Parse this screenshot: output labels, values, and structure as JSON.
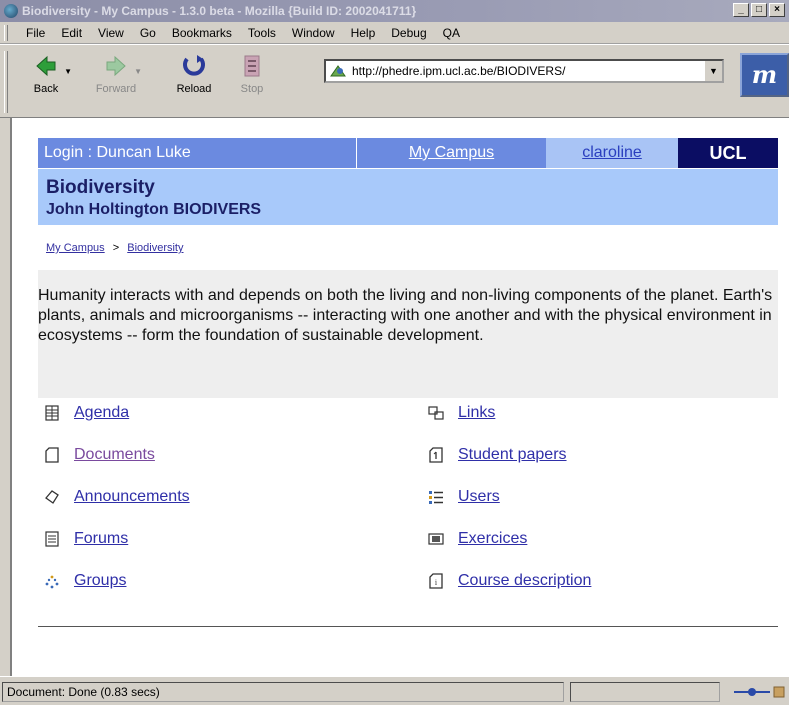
{
  "window": {
    "title": "Biodiversity - My Campus - 1.3.0 beta - Mozilla {Build ID: 2002041711}",
    "controls": [
      "_",
      "□",
      "×"
    ]
  },
  "menu": {
    "items": [
      "File",
      "Edit",
      "View",
      "Go",
      "Bookmarks",
      "Tools",
      "Window",
      "Help",
      "Debug",
      "QA"
    ]
  },
  "toolbar": {
    "back": "Back",
    "forward": "Forward",
    "reload": "Reload",
    "stop": "Stop",
    "url": "http://phedre.ipm.ucl.ac.be/BIODIVERS/"
  },
  "header": {
    "login": "Login : Duncan Luke",
    "my_campus": "My Campus",
    "claroline": "claroline",
    "ucl": "UCL"
  },
  "course": {
    "title": "Biodiversity",
    "subtitle": "John Holtington BIODIVERS"
  },
  "breadcrumb": {
    "home": "My Campus",
    "separator": ">",
    "current": "Biodiversity"
  },
  "description": "Humanity interacts with and depends on both the living and non-living components of the planet. Earth's plants, animals and microorganisms -- interacting with one another and with the physical environment in ecosystems -- form the foundation of sustainable development.",
  "tools": {
    "left": [
      {
        "label": "Agenda",
        "icon": "calendar-grid-icon"
      },
      {
        "label": "Documents",
        "icon": "document-icon"
      },
      {
        "label": "Announcements",
        "icon": "megaphone-icon"
      },
      {
        "label": "Forums",
        "icon": "forum-icon"
      },
      {
        "label": "Groups",
        "icon": "groups-icon"
      }
    ],
    "right": [
      {
        "label": "Links",
        "icon": "links-icon"
      },
      {
        "label": "Student papers",
        "icon": "papers-icon"
      },
      {
        "label": "Users",
        "icon": "users-icon"
      },
      {
        "label": "Exercices",
        "icon": "exercises-icon"
      },
      {
        "label": "Course description",
        "icon": "info-doc-icon"
      }
    ]
  },
  "status": {
    "text": "Document: Done (0.83 secs)"
  },
  "colors": {
    "header_blue": "#6b8ae0",
    "course_bar": "#a8c9fa",
    "ucl_navy": "#0b0d63",
    "link": "#2f2fa8"
  }
}
